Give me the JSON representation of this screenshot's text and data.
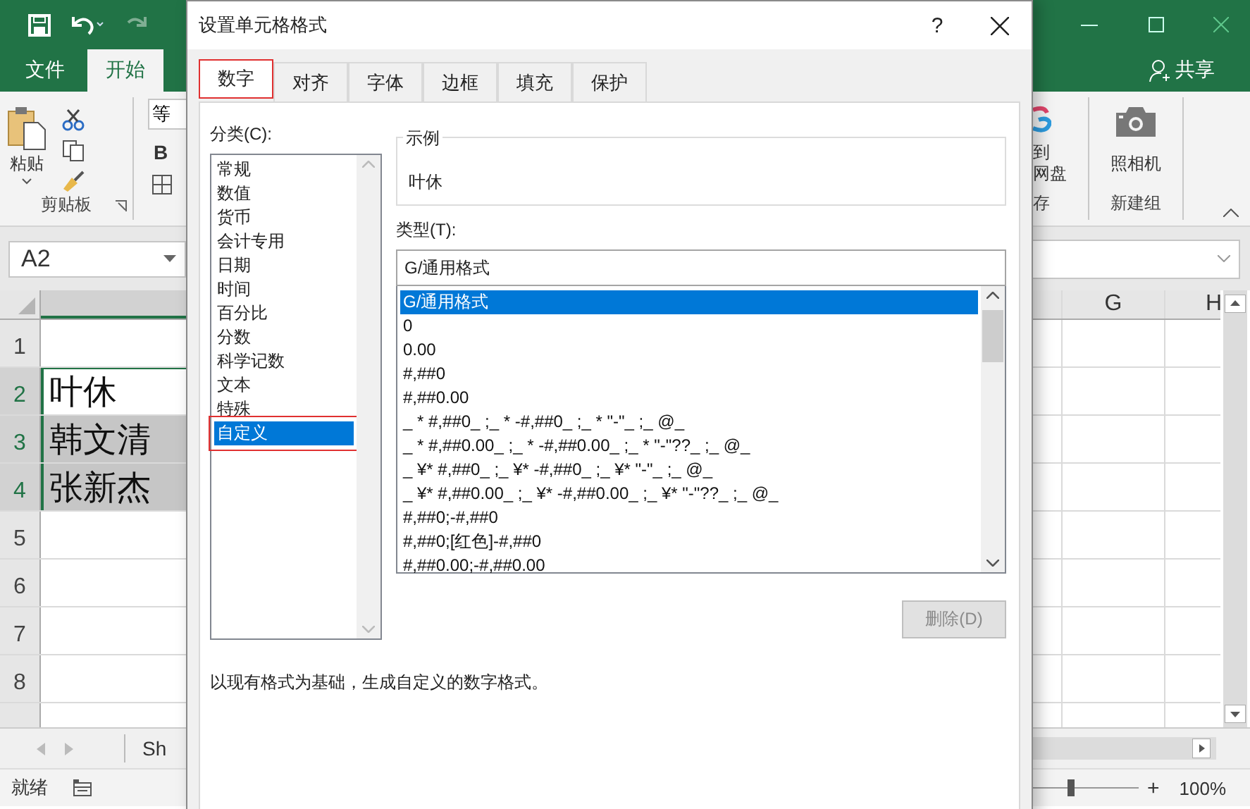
{
  "ribbon_tabs": [
    {
      "label": "文件",
      "selected": false
    },
    {
      "label": "开始",
      "selected": true
    }
  ],
  "ribbon": {
    "paste": "粘贴",
    "clipboard_group": "剪贴板",
    "font_name": "等",
    "bold": "B",
    "save_to": "到",
    "net_disk": "网盘",
    "save_group": "存",
    "camera": "照相机",
    "new_group": "新建组"
  },
  "share": "共享",
  "name_box": "A2",
  "column_headers": [
    "G",
    "H"
  ],
  "rows": [
    {
      "header": "1",
      "text": null,
      "selected": false,
      "active": false
    },
    {
      "header": "2",
      "text": "叶休",
      "selected": true,
      "active": true
    },
    {
      "header": "3",
      "text": "韩文清",
      "selected": true,
      "active": false
    },
    {
      "header": "4",
      "text": "张新杰",
      "selected": true,
      "active": false
    },
    {
      "header": "5",
      "text": null,
      "selected": false,
      "active": false
    },
    {
      "header": "6",
      "text": null,
      "selected": false,
      "active": false
    },
    {
      "header": "7",
      "text": null,
      "selected": false,
      "active": false
    },
    {
      "header": "8",
      "text": null,
      "selected": false,
      "active": false
    }
  ],
  "sheet_tab": "Sh",
  "status_bar": {
    "status": "就绪",
    "zoom_slider": {
      "level": 0.35
    },
    "zoom_in": "+",
    "zoom": "100%"
  },
  "dialog": {
    "title": "设置单元格格式",
    "help": "?",
    "tabs": [
      {
        "label": "数字",
        "selected": true
      },
      {
        "label": "对齐",
        "selected": false
      },
      {
        "label": "字体",
        "selected": false
      },
      {
        "label": "边框",
        "selected": false
      },
      {
        "label": "填充",
        "selected": false
      },
      {
        "label": "保护",
        "selected": false
      }
    ],
    "category_label": "分类(C):",
    "categories": [
      {
        "label": "常规",
        "selected": false
      },
      {
        "label": "数值",
        "selected": false
      },
      {
        "label": "货币",
        "selected": false
      },
      {
        "label": "会计专用",
        "selected": false
      },
      {
        "label": "日期",
        "selected": false
      },
      {
        "label": "时间",
        "selected": false
      },
      {
        "label": "百分比",
        "selected": false
      },
      {
        "label": "分数",
        "selected": false
      },
      {
        "label": "科学记数",
        "selected": false
      },
      {
        "label": "文本",
        "selected": false
      },
      {
        "label": "特殊",
        "selected": false
      },
      {
        "label": "自定义",
        "selected": true
      }
    ],
    "sample_label": "示例",
    "sample_value": "叶休",
    "type_label": "类型(T):",
    "type_value": "G/通用格式",
    "types": [
      {
        "label": "G/通用格式",
        "selected": true
      },
      {
        "label": "0",
        "selected": false
      },
      {
        "label": "0.00",
        "selected": false
      },
      {
        "label": "#,##0",
        "selected": false
      },
      {
        "label": "#,##0.00",
        "selected": false
      },
      {
        "label": "_ * #,##0_ ;_ * -#,##0_ ;_ * \"-\"_ ;_ @_",
        "selected": false
      },
      {
        "label": "_ * #,##0.00_ ;_ * -#,##0.00_ ;_ * \"-\"??_ ;_ @_",
        "selected": false
      },
      {
        "label": "_ ¥* #,##0_ ;_ ¥* -#,##0_ ;_ ¥* \"-\"_ ;_ @_",
        "selected": false
      },
      {
        "label": "_ ¥* #,##0.00_ ;_ ¥* -#,##0.00_ ;_ ¥* \"-\"??_ ;_ @_",
        "selected": false
      },
      {
        "label": "#,##0;-#,##0",
        "selected": false
      },
      {
        "label": "#,##0;[红色]-#,##0",
        "selected": false
      },
      {
        "label": "#,##0.00;-#,##0.00",
        "selected": false
      }
    ],
    "delete_button": {
      "label": "删除(D)",
      "disabled": true
    },
    "description": "以现有格式为基础，生成自定义的数字格式。"
  }
}
